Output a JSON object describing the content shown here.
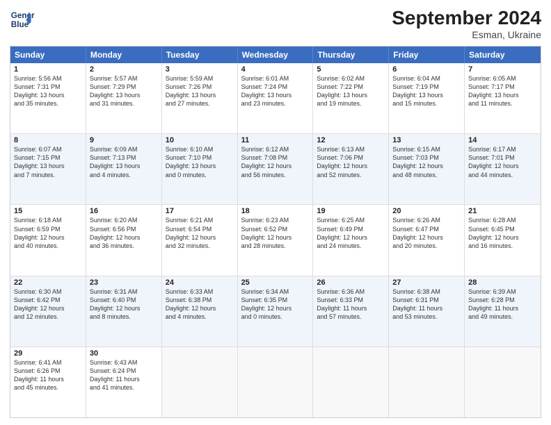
{
  "header": {
    "logo_line1": "General",
    "logo_line2": "Blue",
    "month_year": "September 2024",
    "location": "Esman, Ukraine"
  },
  "days_of_week": [
    "Sunday",
    "Monday",
    "Tuesday",
    "Wednesday",
    "Thursday",
    "Friday",
    "Saturday"
  ],
  "rows": [
    [
      {
        "day": "1",
        "lines": [
          "Sunrise: 5:56 AM",
          "Sunset: 7:31 PM",
          "Daylight: 13 hours",
          "and 35 minutes."
        ]
      },
      {
        "day": "2",
        "lines": [
          "Sunrise: 5:57 AM",
          "Sunset: 7:29 PM",
          "Daylight: 13 hours",
          "and 31 minutes."
        ]
      },
      {
        "day": "3",
        "lines": [
          "Sunrise: 5:59 AM",
          "Sunset: 7:26 PM",
          "Daylight: 13 hours",
          "and 27 minutes."
        ]
      },
      {
        "day": "4",
        "lines": [
          "Sunrise: 6:01 AM",
          "Sunset: 7:24 PM",
          "Daylight: 13 hours",
          "and 23 minutes."
        ]
      },
      {
        "day": "5",
        "lines": [
          "Sunrise: 6:02 AM",
          "Sunset: 7:22 PM",
          "Daylight: 13 hours",
          "and 19 minutes."
        ]
      },
      {
        "day": "6",
        "lines": [
          "Sunrise: 6:04 AM",
          "Sunset: 7:19 PM",
          "Daylight: 13 hours",
          "and 15 minutes."
        ]
      },
      {
        "day": "7",
        "lines": [
          "Sunrise: 6:05 AM",
          "Sunset: 7:17 PM",
          "Daylight: 13 hours",
          "and 11 minutes."
        ]
      }
    ],
    [
      {
        "day": "8",
        "lines": [
          "Sunrise: 6:07 AM",
          "Sunset: 7:15 PM",
          "Daylight: 13 hours",
          "and 7 minutes."
        ]
      },
      {
        "day": "9",
        "lines": [
          "Sunrise: 6:09 AM",
          "Sunset: 7:13 PM",
          "Daylight: 13 hours",
          "and 4 minutes."
        ]
      },
      {
        "day": "10",
        "lines": [
          "Sunrise: 6:10 AM",
          "Sunset: 7:10 PM",
          "Daylight: 13 hours",
          "and 0 minutes."
        ]
      },
      {
        "day": "11",
        "lines": [
          "Sunrise: 6:12 AM",
          "Sunset: 7:08 PM",
          "Daylight: 12 hours",
          "and 56 minutes."
        ]
      },
      {
        "day": "12",
        "lines": [
          "Sunrise: 6:13 AM",
          "Sunset: 7:06 PM",
          "Daylight: 12 hours",
          "and 52 minutes."
        ]
      },
      {
        "day": "13",
        "lines": [
          "Sunrise: 6:15 AM",
          "Sunset: 7:03 PM",
          "Daylight: 12 hours",
          "and 48 minutes."
        ]
      },
      {
        "day": "14",
        "lines": [
          "Sunrise: 6:17 AM",
          "Sunset: 7:01 PM",
          "Daylight: 12 hours",
          "and 44 minutes."
        ]
      }
    ],
    [
      {
        "day": "15",
        "lines": [
          "Sunrise: 6:18 AM",
          "Sunset: 6:59 PM",
          "Daylight: 12 hours",
          "and 40 minutes."
        ]
      },
      {
        "day": "16",
        "lines": [
          "Sunrise: 6:20 AM",
          "Sunset: 6:56 PM",
          "Daylight: 12 hours",
          "and 36 minutes."
        ]
      },
      {
        "day": "17",
        "lines": [
          "Sunrise: 6:21 AM",
          "Sunset: 6:54 PM",
          "Daylight: 12 hours",
          "and 32 minutes."
        ]
      },
      {
        "day": "18",
        "lines": [
          "Sunrise: 6:23 AM",
          "Sunset: 6:52 PM",
          "Daylight: 12 hours",
          "and 28 minutes."
        ]
      },
      {
        "day": "19",
        "lines": [
          "Sunrise: 6:25 AM",
          "Sunset: 6:49 PM",
          "Daylight: 12 hours",
          "and 24 minutes."
        ]
      },
      {
        "day": "20",
        "lines": [
          "Sunrise: 6:26 AM",
          "Sunset: 6:47 PM",
          "Daylight: 12 hours",
          "and 20 minutes."
        ]
      },
      {
        "day": "21",
        "lines": [
          "Sunrise: 6:28 AM",
          "Sunset: 6:45 PM",
          "Daylight: 12 hours",
          "and 16 minutes."
        ]
      }
    ],
    [
      {
        "day": "22",
        "lines": [
          "Sunrise: 6:30 AM",
          "Sunset: 6:42 PM",
          "Daylight: 12 hours",
          "and 12 minutes."
        ]
      },
      {
        "day": "23",
        "lines": [
          "Sunrise: 6:31 AM",
          "Sunset: 6:40 PM",
          "Daylight: 12 hours",
          "and 8 minutes."
        ]
      },
      {
        "day": "24",
        "lines": [
          "Sunrise: 6:33 AM",
          "Sunset: 6:38 PM",
          "Daylight: 12 hours",
          "and 4 minutes."
        ]
      },
      {
        "day": "25",
        "lines": [
          "Sunrise: 6:34 AM",
          "Sunset: 6:35 PM",
          "Daylight: 12 hours",
          "and 0 minutes."
        ]
      },
      {
        "day": "26",
        "lines": [
          "Sunrise: 6:36 AM",
          "Sunset: 6:33 PM",
          "Daylight: 11 hours",
          "and 57 minutes."
        ]
      },
      {
        "day": "27",
        "lines": [
          "Sunrise: 6:38 AM",
          "Sunset: 6:31 PM",
          "Daylight: 11 hours",
          "and 53 minutes."
        ]
      },
      {
        "day": "28",
        "lines": [
          "Sunrise: 6:39 AM",
          "Sunset: 6:28 PM",
          "Daylight: 11 hours",
          "and 49 minutes."
        ]
      }
    ],
    [
      {
        "day": "29",
        "lines": [
          "Sunrise: 6:41 AM",
          "Sunset: 6:26 PM",
          "Daylight: 11 hours",
          "and 45 minutes."
        ]
      },
      {
        "day": "30",
        "lines": [
          "Sunrise: 6:43 AM",
          "Sunset: 6:24 PM",
          "Daylight: 11 hours",
          "and 41 minutes."
        ]
      },
      {
        "day": "",
        "lines": []
      },
      {
        "day": "",
        "lines": []
      },
      {
        "day": "",
        "lines": []
      },
      {
        "day": "",
        "lines": []
      },
      {
        "day": "",
        "lines": []
      }
    ]
  ]
}
